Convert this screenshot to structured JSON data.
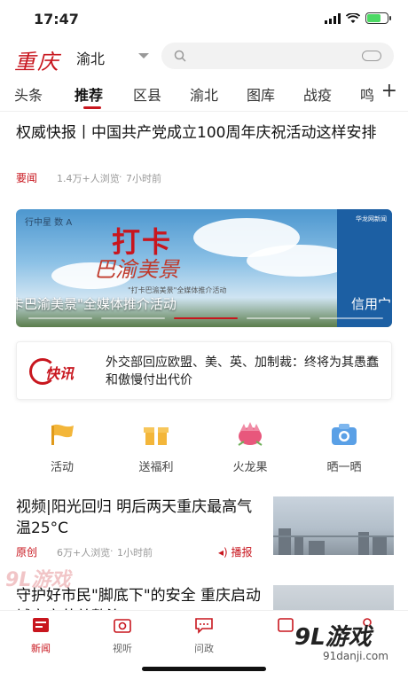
{
  "status_bar": {
    "time": "17:47"
  },
  "header": {
    "logo": "重庆",
    "city": "渝北"
  },
  "tabs": [
    {
      "label": "头条",
      "active": false
    },
    {
      "label": "推荐",
      "active": true
    },
    {
      "label": "区县",
      "active": false
    },
    {
      "label": "渝北",
      "active": false
    },
    {
      "label": "图库",
      "active": false
    },
    {
      "label": "战疫",
      "active": false
    },
    {
      "label": "鸣",
      "active": false
    }
  ],
  "news1": {
    "title": "权威快报丨中国共产党成立100周年庆祝活动这样安排",
    "tag": "要闻",
    "views": "1.4万+人浏览",
    "time": "7小时前"
  },
  "banner": {
    "headline": "打卡",
    "subtitle": "巴渝美景",
    "small": "\"打卡巴渝美景\"全媒体推介活动",
    "caption": "卡巴渝美景\"全媒体推介活动",
    "caption_next": "信用宀",
    "top_left": "行中星 数 A",
    "right_top": "华龙网新闻"
  },
  "flash": {
    "badge": "快讯",
    "text": "外交部回应欧盟、美、英、加制裁：终将为其愚蠢和傲慢付出代价"
  },
  "quick_icons": [
    {
      "label": "活动",
      "icon": "flag-icon",
      "color": "#f3b63a"
    },
    {
      "label": "送福利",
      "icon": "gift-icon",
      "color": "#f3b63a"
    },
    {
      "label": "火龙果",
      "icon": "dragonfruit-icon",
      "color": "#e8577c"
    },
    {
      "label": "晒一晒",
      "icon": "camera-icon",
      "color": "#5aa0e6"
    }
  ],
  "news2": {
    "title": "视频|阳光回归 明后两天重庆最高气温25°C",
    "tag": "原创",
    "views": "6万+人浏览",
    "time": "1小时前",
    "play": "播报"
  },
  "news3": {
    "title": "守护好市民\"脚底下\"的安全 重庆启动城市窨井盖整治"
  },
  "bottom_nav": [
    {
      "label": "新闻",
      "icon": "news-icon",
      "active": true
    },
    {
      "label": "视听",
      "icon": "video-icon",
      "active": false
    },
    {
      "label": "问政",
      "icon": "message-icon",
      "active": false
    },
    {
      "label": "",
      "icon": "service-icon",
      "active": false
    },
    {
      "label": "",
      "icon": "profile-icon",
      "active": false
    }
  ],
  "watermark": {
    "left": "9L游戏",
    "right_big": "9L游戏",
    "right_small": "91danji.com"
  },
  "colors": {
    "brand": "#c8161e"
  }
}
